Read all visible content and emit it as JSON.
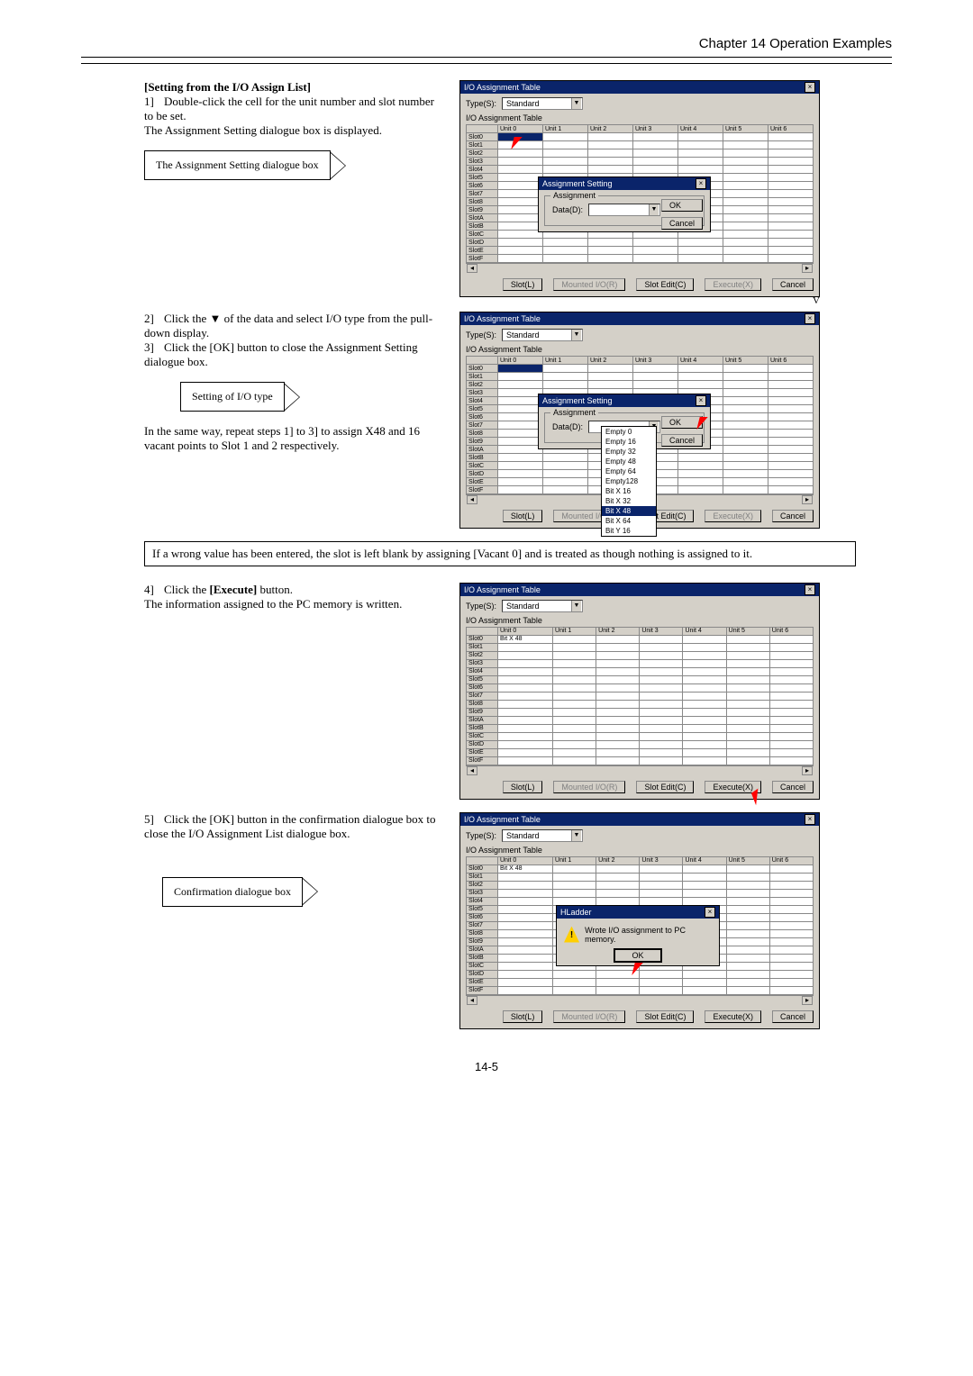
{
  "header": {
    "chapter": "Chapter 14  Operation Examples"
  },
  "section_title": "[Setting from the I/O Assign List]",
  "steps": {
    "s1": {
      "num": "1]",
      "text": "Double-click the cell for the unit number and slot number to be set."
    },
    "s1_after": "The Assignment Setting dialogue box is displayed.",
    "s2": {
      "num": "2]",
      "text": "Click the ▼ of the data and select I/O type from the pull-down display."
    },
    "s3": {
      "num": "3]",
      "text": "Click the [OK] button to close the Assignment Setting dialogue box."
    },
    "s3_after": "In the same way, repeat steps 1] to 3] to assign X48 and 16 vacant points to Slot 1 and 2 respectively.",
    "s4": {
      "num": "4]",
      "text_a": "Click the ",
      "bold": "[Execute]",
      "text_b": " button."
    },
    "s4_after": "The information assigned to the PC memory is written.",
    "s5": {
      "num": "5]",
      "text": "Click the [OK] button in the confirmation dialogue box to close the I/O Assignment List dialogue box."
    }
  },
  "callouts": {
    "c1": "The Assignment Setting dialogue box",
    "c2": "Setting of I/O type",
    "c3": "Confirmation dialogue box"
  },
  "note": "If a wrong value has been entered, the slot is left blank by assigning [Vacant 0] and is treated as though nothing is assigned to it.",
  "win": {
    "title": "I/O Assignment Table",
    "type_label": "Type(S):",
    "type_value": "Standard",
    "subtitle": "I/O Assignment Table",
    "cols": [
      "",
      "Unit 0",
      "Unit 1",
      "Unit 2",
      "Unit 3",
      "Unit 4",
      "Unit 5",
      "Unit 6"
    ],
    "rows": [
      "Slot0",
      "Slot1",
      "Slot2",
      "Slot3",
      "Slot4",
      "Slot5",
      "Slot6",
      "Slot7",
      "Slot8",
      "Slot9",
      "SlotA",
      "SlotB",
      "SlotC",
      "SlotD",
      "SlotE",
      "SlotF"
    ],
    "buttons": {
      "slot": "Slot(L)",
      "mounted": "Mounted I/O(R)",
      "slot_edit": "Slot Edit(C)",
      "execute": "Execute(X)",
      "cancel": "Cancel"
    },
    "cell_slot0_unit0": "Bit X 48",
    "letter_v": "V"
  },
  "assign_dlg": {
    "title": "Assignment Setting",
    "group": "Assignment",
    "data_label": "Data(D):",
    "ok": "OK",
    "cancel": "Cancel"
  },
  "dropdown": {
    "items": [
      "Empty  0",
      "Empty 16",
      "Empty 32",
      "Empty 48",
      "Empty 64",
      "Empty128",
      "Bit X 16",
      "Bit X 32",
      "Bit X 48",
      "Bit X 64",
      "Bit Y 16"
    ],
    "selected_index": 8
  },
  "confirm_dlg": {
    "title": "HLadder",
    "msg": "Wrote I/O assignment to PC memory.",
    "ok": "OK"
  },
  "footer": "14-5"
}
